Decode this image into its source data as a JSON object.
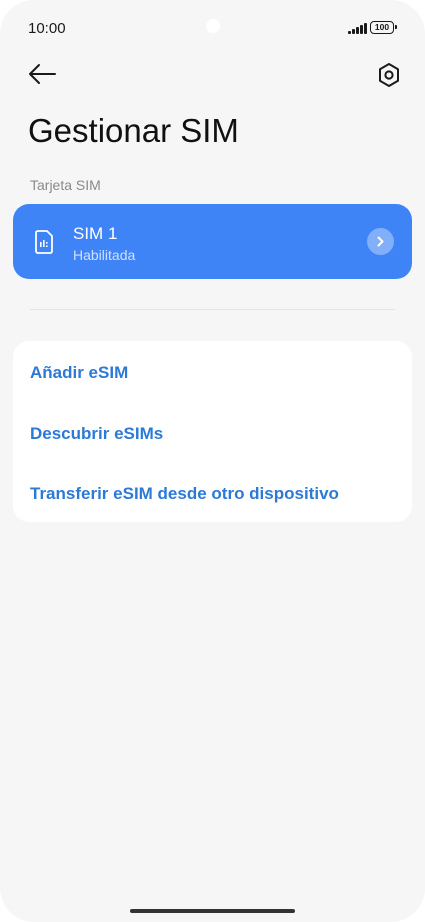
{
  "status_bar": {
    "time": "10:00",
    "battery": "100"
  },
  "header": {
    "back_icon": "arrow-left-icon",
    "settings_icon": "gear-hexagon-icon"
  },
  "page": {
    "title": "Gestionar SIM",
    "section_label": "Tarjeta SIM"
  },
  "sim": {
    "name": "SIM 1",
    "status": "Habilitada",
    "icon": "sim-card-icon",
    "accent_color": "#3f84f7"
  },
  "options": [
    {
      "label": "Añadir eSIM"
    },
    {
      "label": "Descubrir eSIMs"
    },
    {
      "label": "Transferir eSIM desde otro dispositivo"
    }
  ],
  "colors": {
    "link": "#2d7ad6",
    "background": "#f6f6f6"
  }
}
